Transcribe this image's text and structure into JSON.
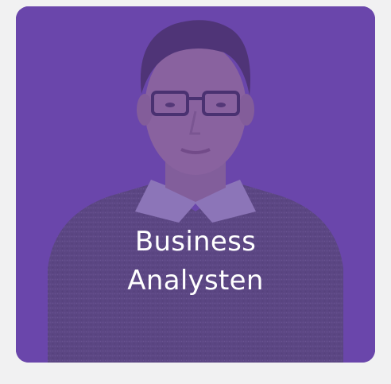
{
  "card": {
    "title_line1": "Business",
    "title_line2": "Analysten",
    "overlay_color": "#6a44ac",
    "image": "person-portrait"
  }
}
